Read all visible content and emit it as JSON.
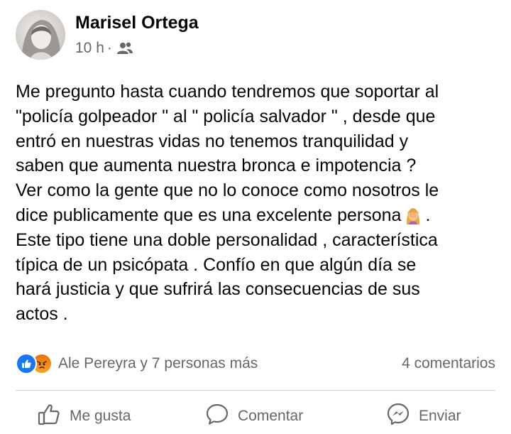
{
  "post": {
    "author": "Marisel Ortega",
    "time": "10 h",
    "separator": "·",
    "audience_icon": "friends-icon",
    "text_main": "Me pregunto hasta cuando tendremos que soportar al\n\"policía golpeador \"  al \" policía salvador \" , desde que\nentró en nuestras vidas no tenemos tranquilidad  y\nsaben que aumenta nuestra bronca  e impotencia ?\nVer como la gente que no lo conoce como nosotros le\ndice publicamente que es una excelente persona",
    "text_end": ".\nEste tipo tiene una doble personalidad , característica\ntípica de un psicópata . Confío en que algún día se\nhará  justicia  y que sufrirá las consecuencias de sus\nactos .",
    "emoji": "person-facepalming-emoji"
  },
  "reactions": {
    "icons": [
      "like-reaction-icon",
      "angry-reaction-icon"
    ],
    "summary": "Ale Pereyra y 7 personas más",
    "comments": "4 comentarios"
  },
  "actions": {
    "like": "Me gusta",
    "comment": "Comentar",
    "send": "Enviar"
  },
  "colors": {
    "text": "#050505",
    "secondary": "#65676b",
    "like_blue": "#1877f2",
    "angry_orange": "#e9710f",
    "divider": "#ced0d4"
  }
}
